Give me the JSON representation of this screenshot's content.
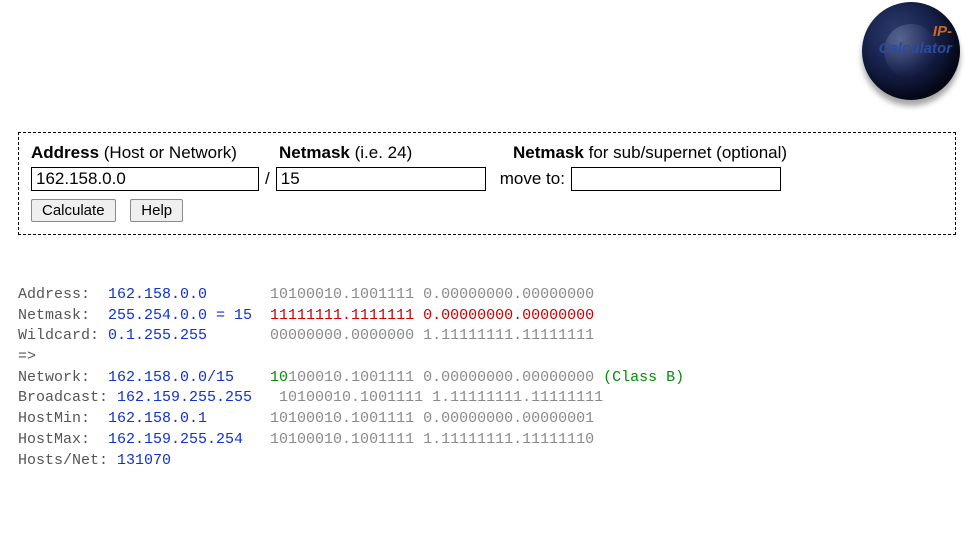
{
  "logo": {
    "line1": "IP-",
    "line2": "Calculator"
  },
  "form": {
    "address_label_b": "Address",
    "address_label_rest": " (Host or Network)",
    "netmask_label_b": "Netmask",
    "netmask_label_rest": " (i.e. 24)",
    "optional_label_b": "Netmask",
    "optional_label_rest": " for sub/supernet (optional)",
    "address_value": "162.158.0.0",
    "netmask_value": "15",
    "moveto_label": "move to:",
    "optional_value": "",
    "calculate_label": "Calculate",
    "help_label": "Help"
  },
  "results": {
    "rows": [
      {
        "key": "Address:  ",
        "val": "162.158.0.0       ",
        "bin_net": "10100010.1001111 ",
        "bin_host": "0.00000000.00000000",
        "style": "normal"
      },
      {
        "key": "Netmask:  ",
        "val": "255.254.0.0 = 15  ",
        "bin_net": "11111111.1111111 ",
        "bin_host": "0.00000000.00000000",
        "style": "mask"
      },
      {
        "key": "Wildcard: ",
        "val": "0.1.255.255       ",
        "bin_net": "00000000.0000000 ",
        "bin_host": "1.11111111.11111111",
        "style": "normal"
      }
    ],
    "arrow": "=>",
    "network": {
      "key": "Network:  ",
      "val": "162.158.0.0/15    ",
      "bin_net_colored_prefix": "10",
      "bin_net_rest": "100010.1001111 ",
      "bin_host": "0.00000000.00000000 ",
      "class_label": "(Class B)"
    },
    "rows2": [
      {
        "key": "Broadcast:",
        "val": " 162.159.255.255   ",
        "bin_net": "10100010.1001111 ",
        "bin_host": "1.11111111.11111111"
      },
      {
        "key": "HostMin:  ",
        "val": "162.158.0.1       ",
        "bin_net": "10100010.1001111 ",
        "bin_host": "0.00000000.00000001"
      },
      {
        "key": "HostMax:  ",
        "val": "162.159.255.254   ",
        "bin_net": "10100010.1001111 ",
        "bin_host": "1.11111111.11111110"
      }
    ],
    "hosts_key": "Hosts/Net:",
    "hosts_val": " 131070"
  }
}
